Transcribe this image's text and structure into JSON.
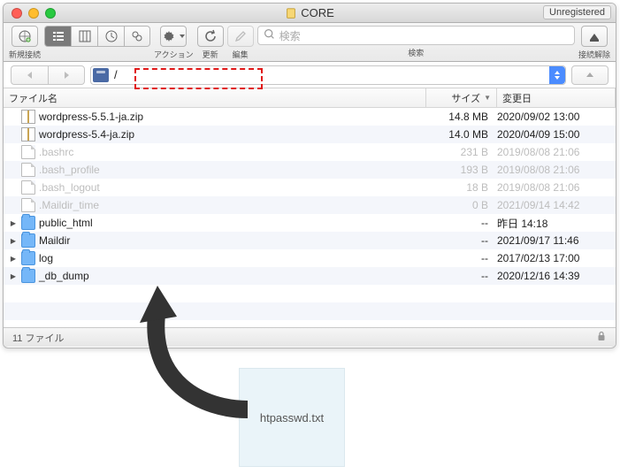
{
  "window": {
    "title": "CORE",
    "badge": "Unregistered"
  },
  "toolbar": {
    "new_connection": "新規接続",
    "action": "アクション",
    "refresh": "更新",
    "edit": "編集",
    "search_placeholder": "検索",
    "search_label": "検索",
    "disconnect": "接続解除"
  },
  "path": {
    "value": "/"
  },
  "columns": {
    "name": "ファイル名",
    "size": "サイズ",
    "date": "変更日"
  },
  "files": [
    {
      "kind": "zip",
      "name": "wordpress-5.5.1-ja.zip",
      "size": "14.8 MB",
      "date": "2020/09/02 13:00",
      "dim": false,
      "folder": false
    },
    {
      "kind": "zip",
      "name": "wordpress-5.4-ja.zip",
      "size": "14.0 MB",
      "date": "2020/04/09 15:00",
      "dim": false,
      "folder": false
    },
    {
      "kind": "file",
      "name": ".bashrc",
      "size": "231 B",
      "date": "2019/08/08 21:06",
      "dim": true,
      "folder": false
    },
    {
      "kind": "file",
      "name": ".bash_profile",
      "size": "193 B",
      "date": "2019/08/08 21:06",
      "dim": true,
      "folder": false
    },
    {
      "kind": "file",
      "name": ".bash_logout",
      "size": "18 B",
      "date": "2019/08/08 21:06",
      "dim": true,
      "folder": false
    },
    {
      "kind": "file",
      "name": ".Maildir_time",
      "size": "0 B",
      "date": "2021/09/14 14:42",
      "dim": true,
      "folder": false
    },
    {
      "kind": "folder",
      "name": "public_html",
      "size": "--",
      "date": "昨日 14:18",
      "dim": false,
      "folder": true
    },
    {
      "kind": "folder",
      "name": "Maildir",
      "size": "--",
      "date": "2021/09/17 11:46",
      "dim": false,
      "folder": true
    },
    {
      "kind": "folder",
      "name": "log",
      "size": "--",
      "date": "2017/02/13 17:00",
      "dim": false,
      "folder": true
    },
    {
      "kind": "folder",
      "name": "_db_dump",
      "size": "--",
      "date": "2020/12/16 14:39",
      "dim": false,
      "folder": true
    }
  ],
  "status": {
    "count": "11 ファイル"
  },
  "note": {
    "filename": "htpasswd.txt"
  }
}
